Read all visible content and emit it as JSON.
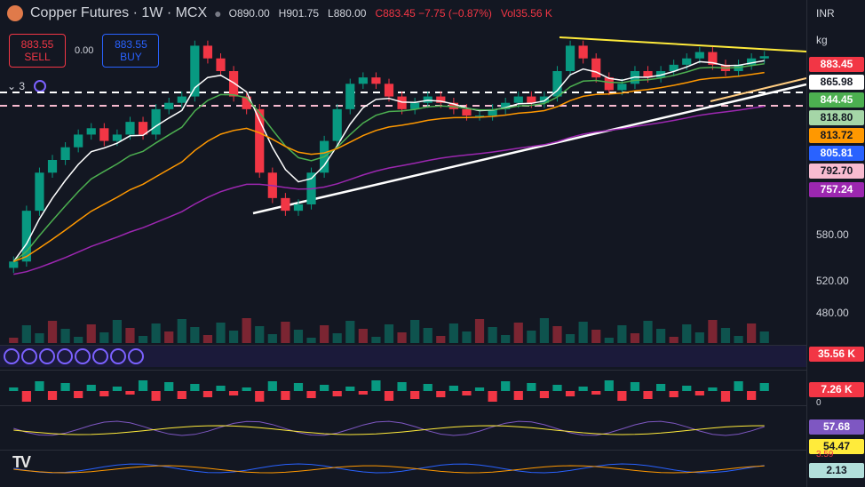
{
  "chart": {
    "title": "Copper Futures · 1W · MCX",
    "ohlc": {
      "o": "O890.00",
      "h": "H901.75",
      "l": "L880.00",
      "c": "C883.45 −7.75 (−0.87%)",
      "vol": "Vol35.56 K"
    },
    "trade": {
      "sell_price": "883.55",
      "sell_label": "SELL",
      "buy_price": "883.55",
      "buy_label": "BUY",
      "spread": "0.00"
    },
    "toolbar": {
      "indicators_count": "3"
    },
    "axis": {
      "currency": "INR",
      "unit": "kg",
      "ticks": [
        "580.00",
        "520.00",
        "480.00"
      ],
      "price_labels": [
        {
          "value": "883.45",
          "bg": "#f23645",
          "fg": "#ffffff"
        },
        {
          "value": "865.98",
          "bg": "#ffffff",
          "fg": "#131722"
        },
        {
          "value": "844.45",
          "bg": "#4caf50",
          "fg": "#ffffff"
        },
        {
          "value": "818.80",
          "bg": "#a5d6a7",
          "fg": "#131722"
        },
        {
          "value": "813.72",
          "bg": "#ff9800",
          "fg": "#131722"
        },
        {
          "value": "805.81",
          "bg": "#2962ff",
          "fg": "#ffffff"
        },
        {
          "value": "792.70",
          "bg": "#f8bbd0",
          "fg": "#131722"
        },
        {
          "value": "757.24",
          "bg": "#9c27b0",
          "fg": "#ffffff"
        }
      ]
    },
    "panels": {
      "volume_label": "35.56 K",
      "volume_color": "#f23645",
      "delta_label": "7.26 K",
      "delta_extra": "0",
      "rsi_label": "57.68",
      "rsi_color": "#7e57c2",
      "ma_label": "54.47",
      "ma_color": "#ffeb3b",
      "macd_hist": "3.59",
      "macd_label": "2.13",
      "macd_color": "#b2dfdb"
    }
  },
  "chart_data": {
    "type": "candlestick",
    "title": "Copper Futures",
    "timeframe": "1W",
    "exchange": "MCX",
    "last": 883.45,
    "ylim": [
      440,
      930
    ],
    "series": [
      {
        "name": "close",
        "values": [
          560,
          640,
          700,
          720,
          740,
          760,
          770,
          750,
          760,
          780,
          760,
          800,
          810,
          820,
          900,
          880,
          860,
          820,
          800,
          700,
          660,
          640,
          650,
          700,
          750,
          800,
          840,
          850,
          840,
          820,
          800,
          810,
          820,
          810,
          800,
          790,
          790,
          800,
          810,
          820,
          810,
          820,
          860,
          900,
          880,
          850,
          830,
          840,
          860,
          850,
          860,
          870,
          880,
          890,
          870,
          860,
          870,
          880,
          883.45
        ]
      }
    ]
  }
}
